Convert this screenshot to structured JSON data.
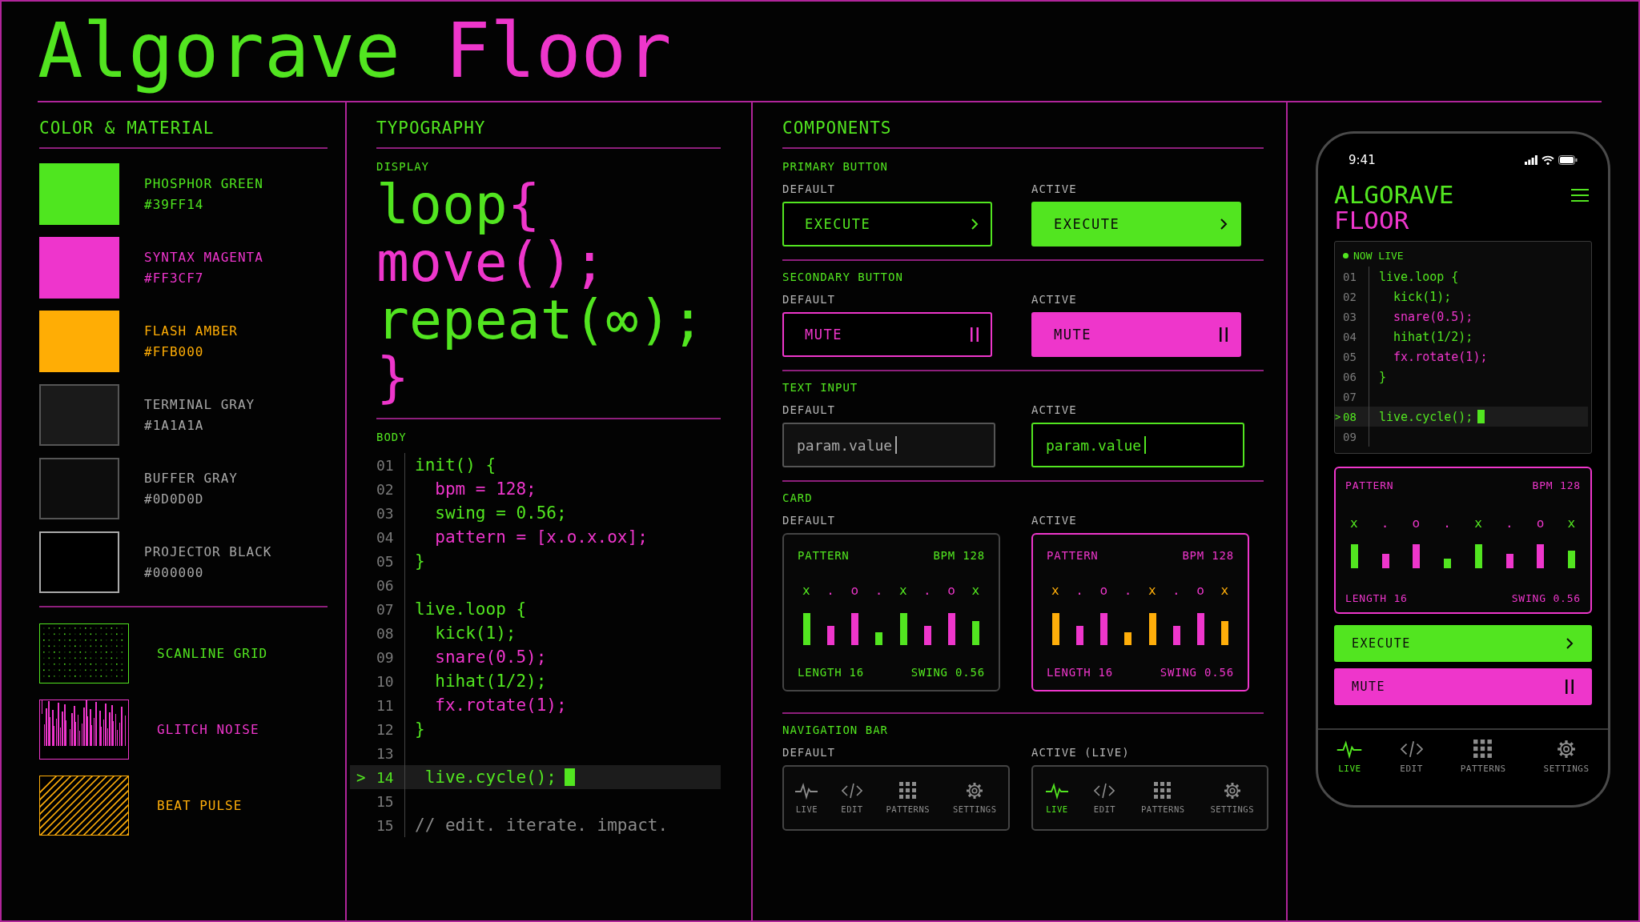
{
  "title": [
    {
      "text": "Algorave",
      "color": "#52e520"
    },
    {
      "text": "Floor",
      "color": "#ee36cb"
    }
  ],
  "color_material": {
    "heading": "COLOR & MATERIAL",
    "swatches": [
      {
        "name": "PHOSPHOR GREEN",
        "hex": "#39FF14",
        "kind": "solid",
        "color": "#4fe61f"
      },
      {
        "name": "SYNTAX MAGENTA",
        "hex": "#FF3CF7",
        "kind": "solid",
        "color": "#ee35cc"
      },
      {
        "name": "FLASH AMBER",
        "hex": "#FFB000",
        "kind": "solid",
        "color": "#ffad05"
      },
      {
        "name": "TERMINAL GRAY",
        "hex": "#1A1A1A",
        "kind": "dark",
        "color": "#1a1a1a"
      },
      {
        "name": "BUFFER GRAY",
        "hex": "#0D0D0D",
        "kind": "dark",
        "color": "#0d0d0d"
      },
      {
        "name": "PROJECTOR BLACK",
        "hex": "#000000",
        "kind": "dark",
        "color": "#000000"
      }
    ],
    "materials": [
      {
        "name": "SCANLINE GRID",
        "kind": "scanline",
        "color": "#52e520"
      },
      {
        "name": "GLITCH NOISE",
        "kind": "glitch",
        "color": "#ee36cb"
      },
      {
        "name": "BEAT PULSE",
        "kind": "pulse",
        "color": "#ffae0a"
      }
    ]
  },
  "typography": {
    "heading": "TYPOGRAPHY",
    "display_label": "DISPLAY",
    "display_lines": [
      [
        {
          "text": "loop",
          "color": "#52e520"
        },
        {
          "text": "{",
          "color": "#ee36cb"
        }
      ],
      [
        {
          "text": "move();",
          "color": "#ee36cb"
        }
      ],
      [
        {
          "text": "repeat(∞);",
          "color": "#52e520"
        }
      ],
      [
        {
          "text": "}",
          "color": "#ee36cb"
        }
      ]
    ],
    "body_label": "BODY",
    "code_lines": [
      {
        "number": "01",
        "text": "init() {",
        "color": "#52e520",
        "current": false
      },
      {
        "number": "02",
        "text": "  bpm = 128;",
        "color": "#ee36cb",
        "current": false
      },
      {
        "number": "03",
        "text": "  swing = 0.56;",
        "color": "#52e520",
        "current": false
      },
      {
        "number": "04",
        "text": "  pattern = [x.o.x.ox];",
        "color": "#ee36cb",
        "current": false
      },
      {
        "number": "05",
        "text": "}",
        "color": "#52e520",
        "current": false
      },
      {
        "number": "06",
        "current": false
      },
      {
        "number": "07",
        "text": "live.loop {",
        "color": "#52e520",
        "current": false
      },
      {
        "number": "08",
        "text": "  kick(1);",
        "color": "#52e520",
        "current": false
      },
      {
        "number": "09",
        "text": "  snare(0.5);",
        "color": "#ee36cb",
        "current": false
      },
      {
        "number": "10",
        "text": "  hihat(1/2);",
        "color": "#52e520",
        "current": false
      },
      {
        "number": "11",
        "text": "  fx.rotate(1);",
        "color": "#ee36cb",
        "current": false
      },
      {
        "number": "12",
        "text": "}",
        "color": "#52e520",
        "current": false
      },
      {
        "number": "13",
        "current": false
      },
      {
        "number": "14",
        "marker": ">",
        "text": " live.cycle();",
        "color": "#52e520",
        "current": true
      },
      {
        "number": "15",
        "current": false
      },
      {
        "number": "15",
        "text": "// edit. iterate. impact.",
        "color": "#8a8a8a",
        "current": false
      }
    ]
  },
  "components": {
    "heading": "COMPONENTS",
    "sections": [
      {
        "kind": "primary_button",
        "label": "PRIMARY BUTTON",
        "variants": [
          {
            "state_label": "DEFAULT",
            "text": "EXECUTE",
            "active": false
          },
          {
            "state_label": "ACTIVE",
            "text": "EXECUTE",
            "active": true
          }
        ]
      },
      {
        "kind": "secondary_button",
        "label": "SECONDARY BUTTON",
        "variants": [
          {
            "state_label": "DEFAULT",
            "text": "MUTE",
            "active": false
          },
          {
            "state_label": "ACTIVE",
            "text": "MUTE",
            "active": true
          }
        ]
      },
      {
        "kind": "text_input",
        "label": "TEXT INPUT",
        "variants": [
          {
            "state_label": "DEFAULT",
            "value": "param.value",
            "active": false
          },
          {
            "state_label": "ACTIVE",
            "value": "param.value",
            "active": true
          }
        ]
      },
      {
        "kind": "card",
        "label": "CARD",
        "variants": [
          {
            "state_label": "DEFAULT",
            "active": false,
            "color": "#52e520",
            "title": "PATTERN",
            "bpm": "BPM 128",
            "steps": [
              "x",
              ".",
              "o",
              ".",
              "x",
              ".",
              "o",
              "x"
            ],
            "length": "LENGTH 16",
            "swing": "SWING 0.56"
          },
          {
            "state_label": "ACTIVE",
            "active": true,
            "color": "#ffae0a",
            "title": "PATTERN",
            "bpm": "BPM 128",
            "steps": [
              "x",
              ".",
              "o",
              ".",
              "x",
              ".",
              "o",
              "x"
            ],
            "length": "LENGTH 16",
            "swing": "SWING 0.56"
          }
        ]
      },
      {
        "kind": "navigation_bar",
        "label": "NAVIGATION BAR",
        "variants": [
          {
            "state_label": "DEFAULT",
            "items": [
              {
                "label": "LIVE",
                "kind": "pulse",
                "selected": false
              },
              {
                "label": "EDIT",
                "kind": "code",
                "selected": false
              },
              {
                "label": "PATTERNS",
                "kind": "grid",
                "selected": false
              },
              {
                "label": "SETTINGS",
                "kind": "gear",
                "selected": false
              }
            ]
          },
          {
            "state_label": "ACTIVE (LIVE)",
            "items": [
              {
                "label": "LIVE",
                "kind": "pulse",
                "selected": true
              },
              {
                "label": "EDIT",
                "kind": "code",
                "selected": false
              },
              {
                "label": "PATTERNS",
                "kind": "grid",
                "selected": false
              },
              {
                "label": "SETTINGS",
                "kind": "gear",
                "selected": false
              }
            ]
          }
        ]
      }
    ]
  },
  "phone": {
    "time": "9:41",
    "app_title": [
      {
        "text": "ALGORAVE",
        "color": "#52e520"
      },
      {
        "text": "FLOOR",
        "color": "#ee36cb"
      }
    ],
    "live_label": "NOW LIVE",
    "code_lines": [
      {
        "number": "01",
        "text": "live.loop {",
        "color": "#52e520",
        "current": false
      },
      {
        "number": "02",
        "text": "  kick(1);",
        "color": "#52e520",
        "current": false
      },
      {
        "number": "03",
        "text": "  snare(0.5);",
        "color": "#ee36cb",
        "current": false
      },
      {
        "number": "04",
        "text": "  hihat(1/2);",
        "color": "#52e520",
        "current": false
      },
      {
        "number": "05",
        "text": "  fx.rotate(1);",
        "color": "#ee36cb",
        "current": false
      },
      {
        "number": "06",
        "text": "}",
        "color": "#52e520",
        "current": false
      },
      {
        "number": "07",
        "current": false
      },
      {
        "number": "08",
        "marker": ">",
        "text": "live.cycle();",
        "color": "#52e520",
        "current": true
      },
      {
        "number": "09",
        "current": false
      }
    ],
    "card": {
      "active": true,
      "color": "#52e520",
      "title": "PATTERN",
      "bpm": "BPM 128",
      "steps": [
        "x",
        ".",
        "o",
        ".",
        "x",
        ".",
        "o",
        "x"
      ],
      "length": "LENGTH 16",
      "swing": "SWING 0.56"
    },
    "buttons": [
      {
        "kind": "primary_button",
        "text": "EXECUTE",
        "active": true
      },
      {
        "kind": "secondary_button",
        "text": "MUTE",
        "active": true
      }
    ],
    "nav_items": [
      {
        "label": "LIVE",
        "kind": "pulse",
        "selected": true
      },
      {
        "label": "EDIT",
        "kind": "code",
        "selected": false
      },
      {
        "label": "PATTERNS",
        "kind": "grid",
        "selected": false
      },
      {
        "label": "SETTINGS",
        "kind": "gear",
        "selected": false
      }
    ]
  }
}
